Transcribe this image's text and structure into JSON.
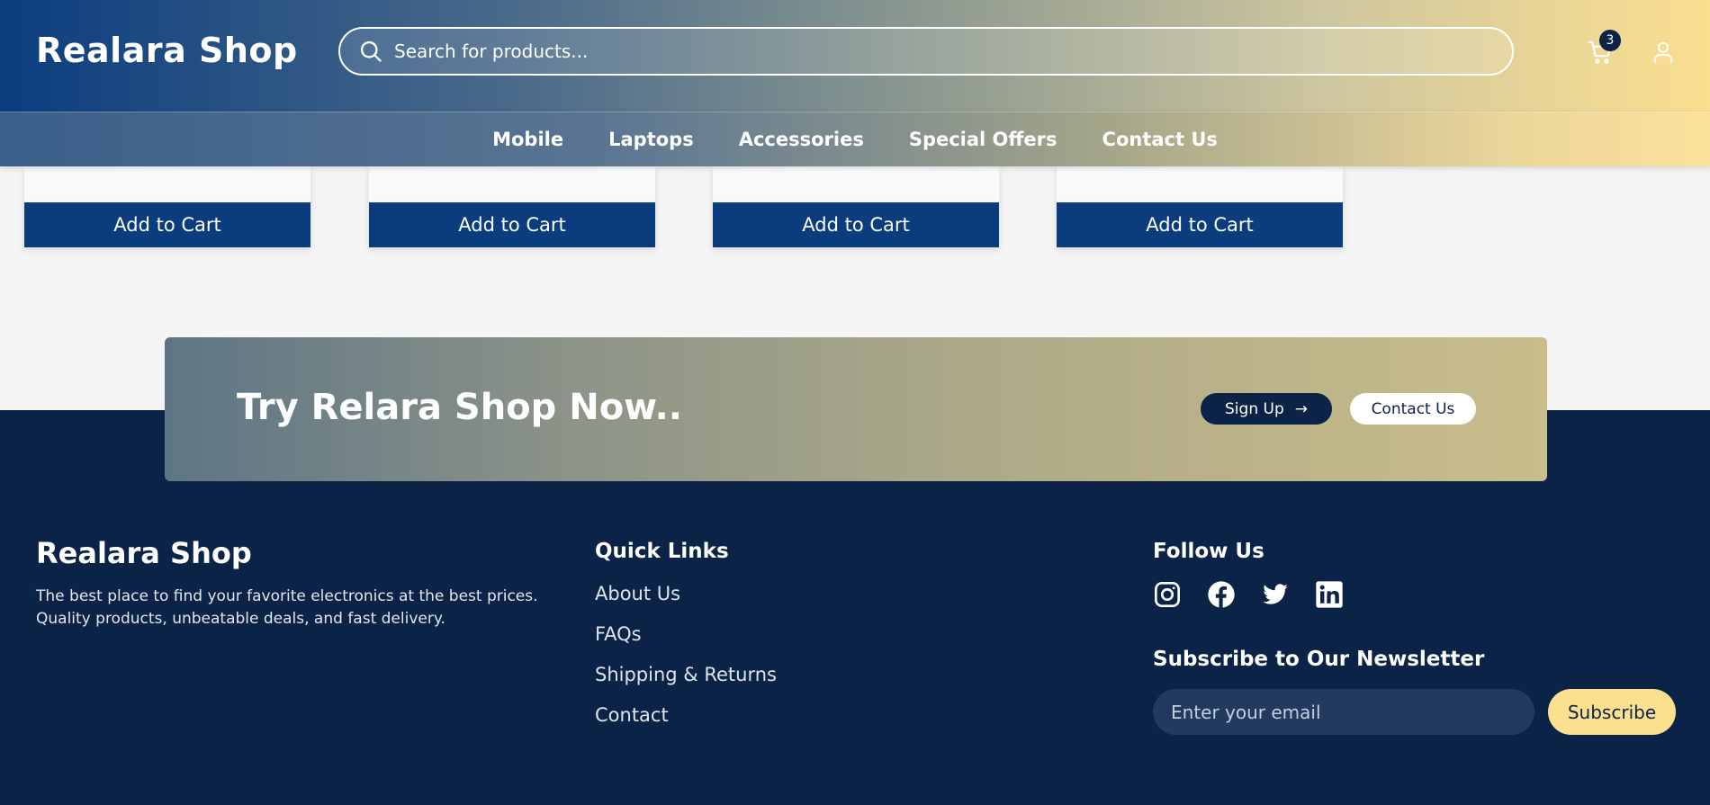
{
  "header": {
    "brand": "Realara Shop",
    "search_placeholder": "Search for products...",
    "cart_count": "3"
  },
  "nav": {
    "items": [
      "Mobile",
      "Laptops",
      "Accessories",
      "Special Offers",
      "Contact Us"
    ]
  },
  "products": {
    "add_to_cart_label": "Add to Cart"
  },
  "cta": {
    "title": "Try Relara Shop Now..",
    "signup_label": "Sign Up",
    "signup_arrow": "→",
    "contact_label": "Contact Us"
  },
  "footer": {
    "brand": "Realara Shop",
    "tagline_line1": "The best place to find your favorite electronics at the best prices.",
    "tagline_line2": "Quality products, unbeatable deals, and fast delivery.",
    "quick_links_heading": "Quick Links",
    "quick_links": [
      "About Us",
      "FAQs",
      "Shipping & Returns",
      "Contact"
    ],
    "follow_heading": "Follow Us",
    "social_icons": [
      "instagram-icon",
      "facebook-icon",
      "twitter-icon",
      "linkedin-icon"
    ],
    "newsletter_heading": "Subscribe to Our Newsletter",
    "email_placeholder": "Enter your email",
    "subscribe_label": "Subscribe"
  },
  "colors": {
    "primary": "#0b3d7e",
    "footer_bg": "#0a2347",
    "accent": "#fbe08f"
  }
}
